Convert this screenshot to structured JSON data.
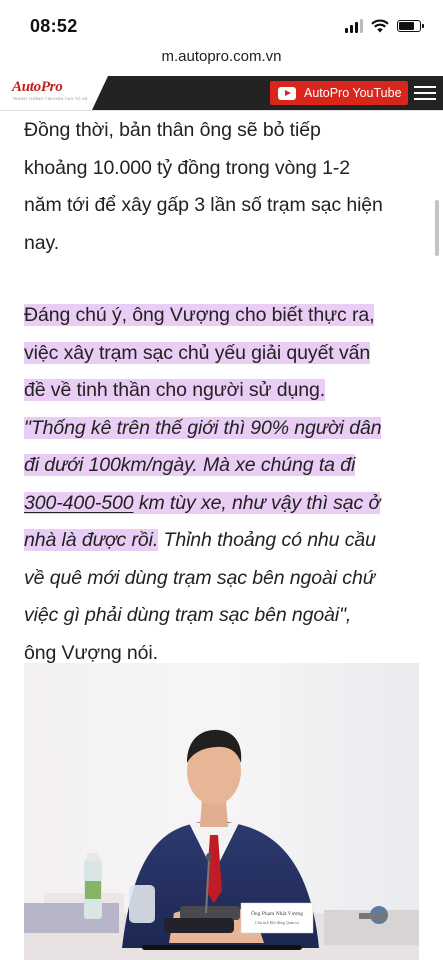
{
  "status": {
    "time": "08:52",
    "battery_level": 0.8
  },
  "browser": {
    "url": "m.autopro.com.vn"
  },
  "header": {
    "logo": "AutoPro",
    "logo_tagline": "TRANG THÔNG TIN KIẾN TẠO TÒ XE",
    "youtube_button": "AutoPro YouTube",
    "menu_icon": "hamburger-menu-icon",
    "youtube_icon": "play-icon"
  },
  "article": {
    "para1": {
      "line1": "Đồng thời, bản thân ông sẽ bỏ tiếp",
      "line2": "khoảng 10.000 tỷ đồng trong vòng 1-2",
      "line3": "năm tới để xây gấp 3 lần số trạm sạc hiện",
      "line4": "nay."
    },
    "para2": {
      "l1": "Đáng chú ý, ông Vượng cho biết thực ra,",
      "l2": "việc xây trạm sạc chủ yếu giải quyết vấn",
      "l3": "đề về tinh thần cho người sử dụng.",
      "l4": "\"Thống kê trên thế giới thì 90% người dân",
      "l5": "đi dưới 100km/ngày. Mà xe chúng ta đi",
      "l6_underlined": "300-400-500",
      "l6_rest": " km tùy xe, như vậy thì sạc ở",
      "l7_highlighted": "nhà là được rồi.",
      "l7_rest": " Thỉnh thoảng có nhu cầu",
      "l8": "về quê mới dùng trạm sạc bên ngoài chứ",
      "l9": "việc gì phải dùng trạm sạc bên ngoài\",",
      "l10": "ông Vượng nói."
    },
    "highlight_color": "#e9cdf4"
  },
  "photo": {
    "nameplate_name": "Ông Phạm Nhật Vượng",
    "nameplate_title": "Chủ tịch Hội đồng Quản trị"
  },
  "colors": {
    "brand_red": "#d9251c",
    "header_dark": "#232323"
  }
}
